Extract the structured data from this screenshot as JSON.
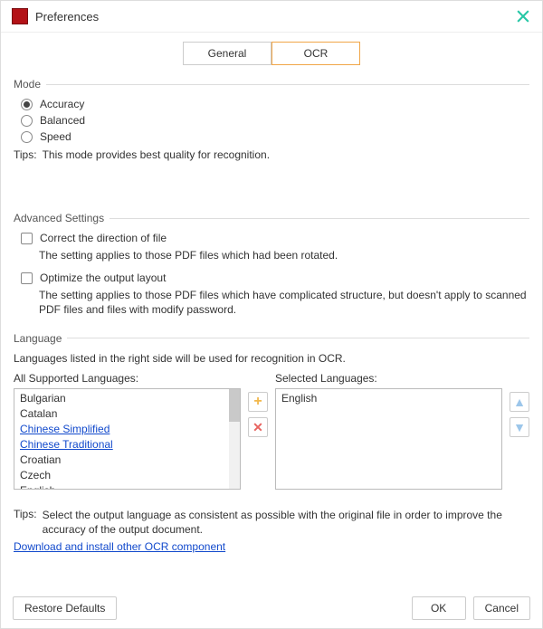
{
  "window": {
    "title": "Preferences"
  },
  "tabs": {
    "general": "General",
    "ocr": "OCR",
    "active": "ocr"
  },
  "mode": {
    "legend": "Mode",
    "options": {
      "accuracy": "Accuracy",
      "balanced": "Balanced",
      "speed": "Speed"
    },
    "selected": "accuracy",
    "tips_label": "Tips:",
    "tips_text": "This mode provides best quality for recognition."
  },
  "advanced": {
    "legend": "Advanced Settings",
    "correct_direction": {
      "label": "Correct the direction of file",
      "checked": false,
      "desc": "The setting applies to those PDF files which had been rotated."
    },
    "optimize_layout": {
      "label": "Optimize the output layout",
      "checked": false,
      "desc": "The setting applies to those PDF files which have complicated structure, but doesn't apply to scanned PDF files and files with modify password."
    }
  },
  "language": {
    "legend": "Language",
    "desc": "Languages listed in the right side will be used for recognition in OCR.",
    "all_header": "All Supported Languages:",
    "selected_header": "Selected Languages:",
    "all_items": [
      {
        "label": "Bulgarian",
        "link": false
      },
      {
        "label": "Catalan",
        "link": false
      },
      {
        "label": "Chinese Simplified",
        "link": true
      },
      {
        "label": "Chinese Traditional",
        "link": true
      },
      {
        "label": "Croatian",
        "link": false
      },
      {
        "label": "Czech",
        "link": false
      },
      {
        "label": "English",
        "link": false
      }
    ],
    "selected_items": [
      {
        "label": "English"
      }
    ],
    "tips_label": "Tips:",
    "tips_text": "Select the output language as consistent as possible with the original file in order to improve the accuracy of the output document.",
    "download_link": "Download and install other OCR component"
  },
  "footer": {
    "restore": "Restore Defaults",
    "ok": "OK",
    "cancel": "Cancel"
  }
}
